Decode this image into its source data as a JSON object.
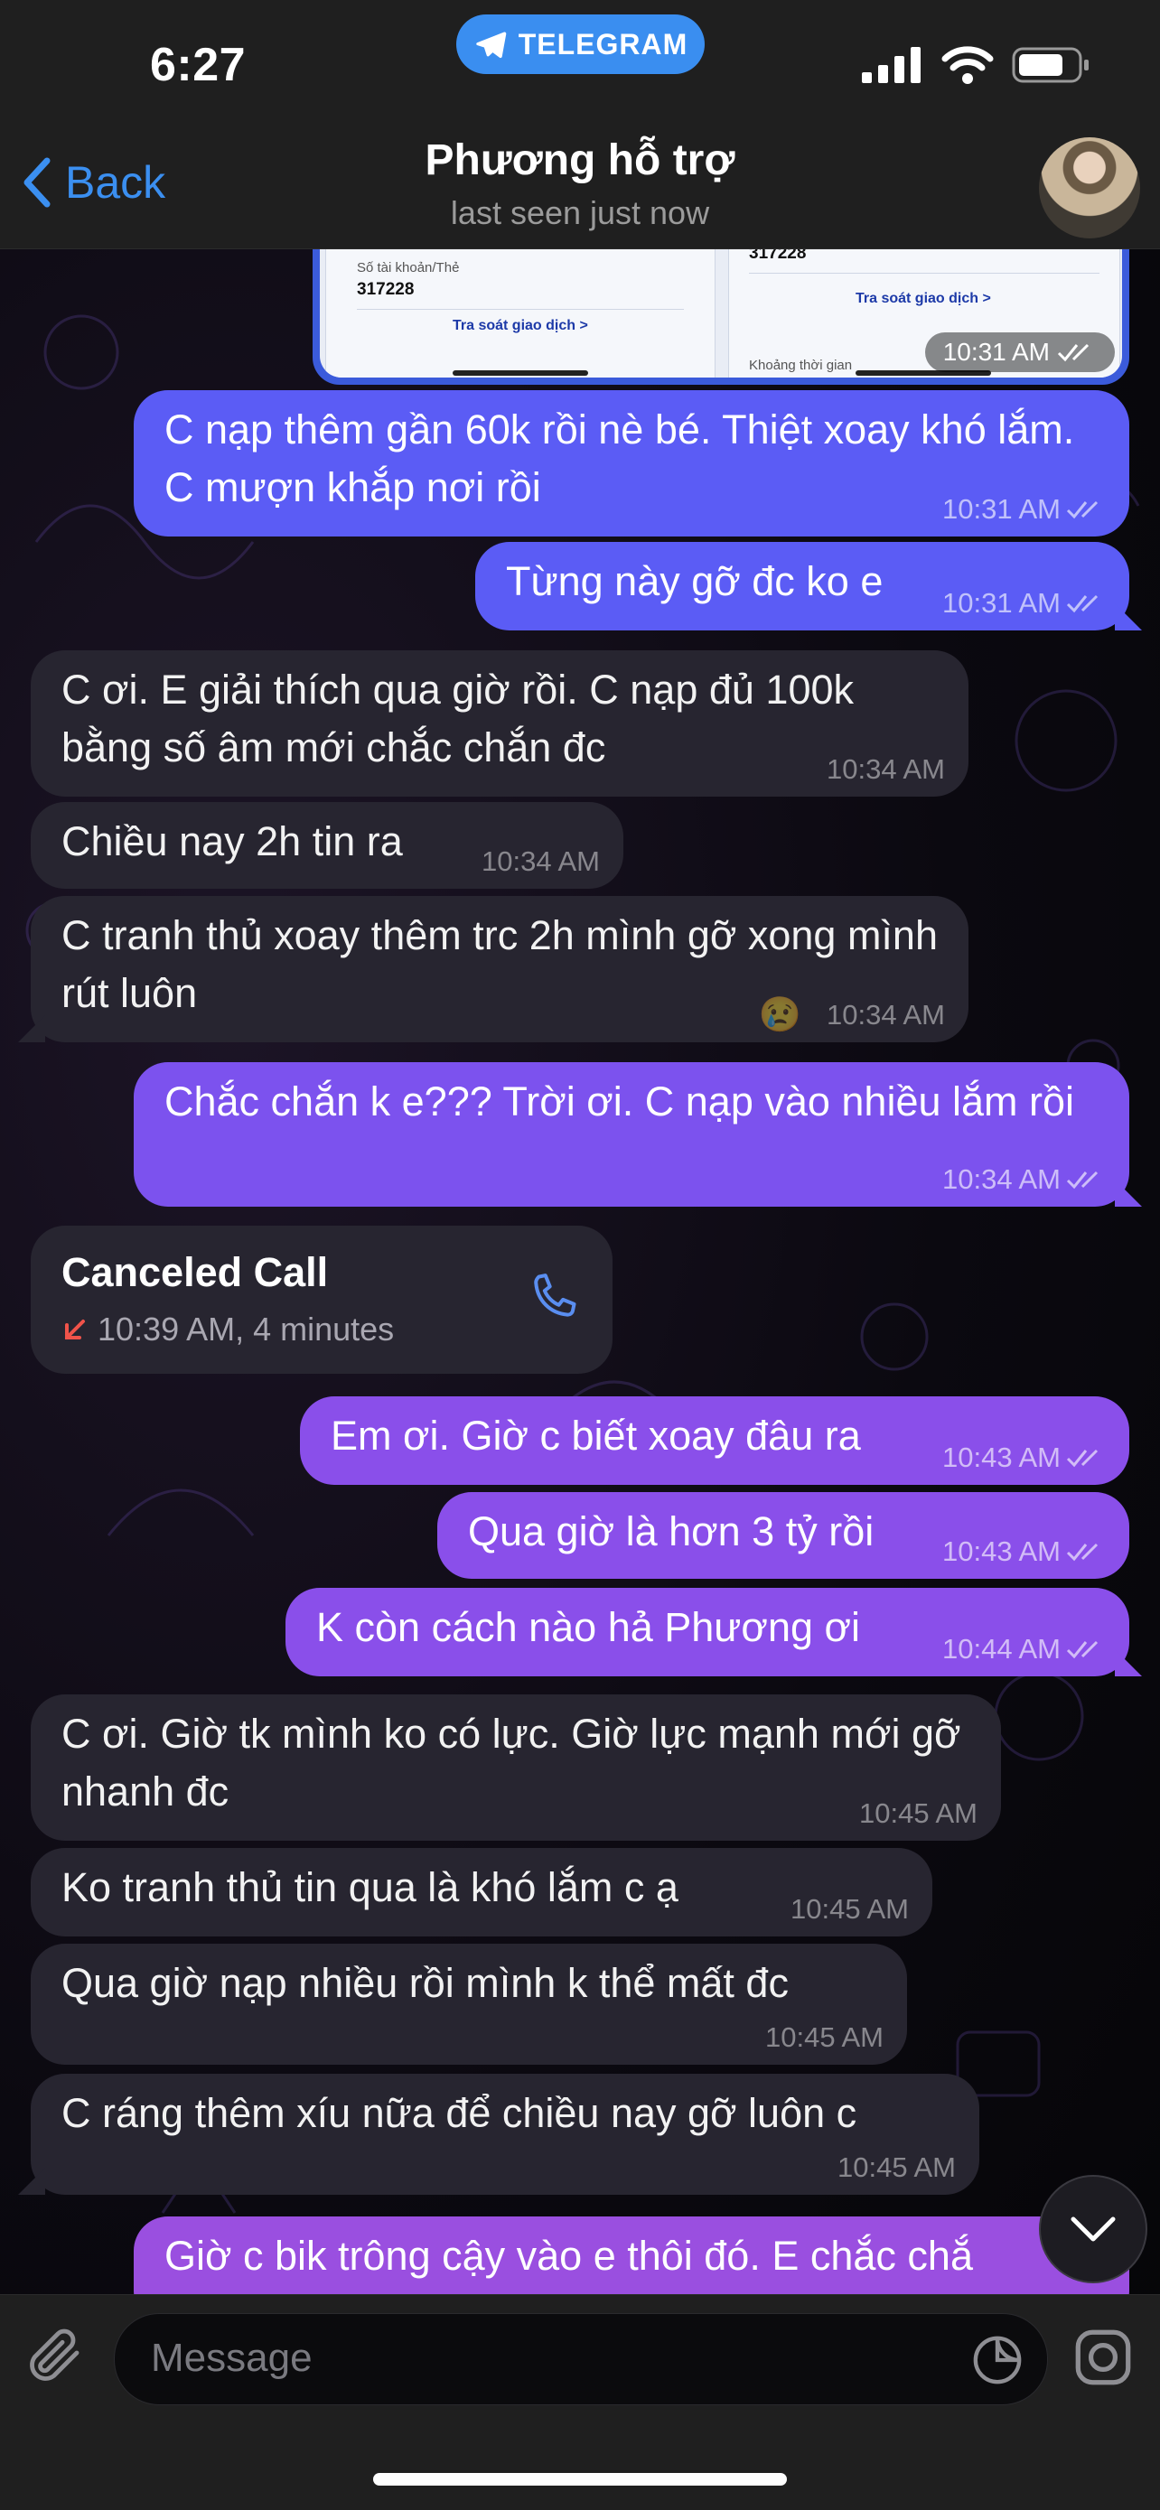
{
  "status_bar": {
    "time": "6:27",
    "badge": "TELEGRAM"
  },
  "header": {
    "back_label": "Back",
    "title": "Phương hỗ trợ",
    "subtitle": "last seen just now"
  },
  "image_message": {
    "left_label": "Số tài khoản/Thẻ",
    "left_number": "317228",
    "left_link": "Tra soát giao dịch  >",
    "right_number": "317228",
    "right_link": "Tra soát giao dịch  >",
    "right_label": "Khoảng thời gian",
    "time": "10:31 AM"
  },
  "messages": [
    {
      "dir": "out",
      "text": "C nạp thêm gần 60k rồi nè bé. Thiệt xoay khó lắm. C mượn khắp nơi rồi",
      "time": "10:31 AM",
      "color": "#5b5cf5"
    },
    {
      "dir": "out",
      "text": "Từng này gỡ đc ko e",
      "time": "10:31 AM",
      "color": "#5b5cf5"
    },
    {
      "dir": "in",
      "text": "C ơi. E giải thích qua giờ rồi. C nạp đủ 100k bằng số âm mới chắc chắn đc",
      "time": "10:34 AM"
    },
    {
      "dir": "in",
      "text": "Chiều nay 2h tin ra",
      "time": "10:34 AM"
    },
    {
      "dir": "in",
      "text": "C tranh thủ xoay thêm trc 2h mình gỡ xong mình rút luôn",
      "time": "10:34 AM",
      "reaction": "😢"
    },
    {
      "dir": "out",
      "text": "Chắc chắn k e??? Trời ơi. C nạp vào nhiều lắm rồi",
      "time": "10:34 AM",
      "color": "#7c52ee"
    },
    {
      "dir": "out",
      "text": "Em ơi. Giờ c biết xoay đâu ra",
      "time": "10:43 AM",
      "color": "#8a4fea"
    },
    {
      "dir": "out",
      "text": "Qua giờ là hơn 3 tỷ rồi",
      "time": "10:43 AM",
      "color": "#8a4fea"
    },
    {
      "dir": "out",
      "text": "K còn cách nào hả Phương ơi",
      "time": "10:44 AM",
      "color": "#8a4fea"
    },
    {
      "dir": "in",
      "text": "C ơi. Giờ tk mình ko có lực. Giờ lực mạnh mới gỡ nhanh đc",
      "time": "10:45 AM"
    },
    {
      "dir": "in",
      "text": "Ko tranh thủ tin qua là khó lắm c ạ",
      "time": "10:45 AM"
    },
    {
      "dir": "in",
      "text": "Qua giờ nạp nhiều rồi mình k thể mất đc",
      "time": "10:45 AM"
    },
    {
      "dir": "in",
      "text": "C ráng thêm xíu nữa để chiều nay gỡ luôn c",
      "time": "10:45 AM"
    },
    {
      "dir": "out",
      "text": "Giờ c bik trông cậy vào e thôi đó. E chắc chắ",
      "time": "",
      "color": "#9a4fe0"
    }
  ],
  "call": {
    "title": "Canceled Call",
    "detail": "10:39 AM, 4 minutes"
  },
  "composer": {
    "placeholder": "Message"
  }
}
